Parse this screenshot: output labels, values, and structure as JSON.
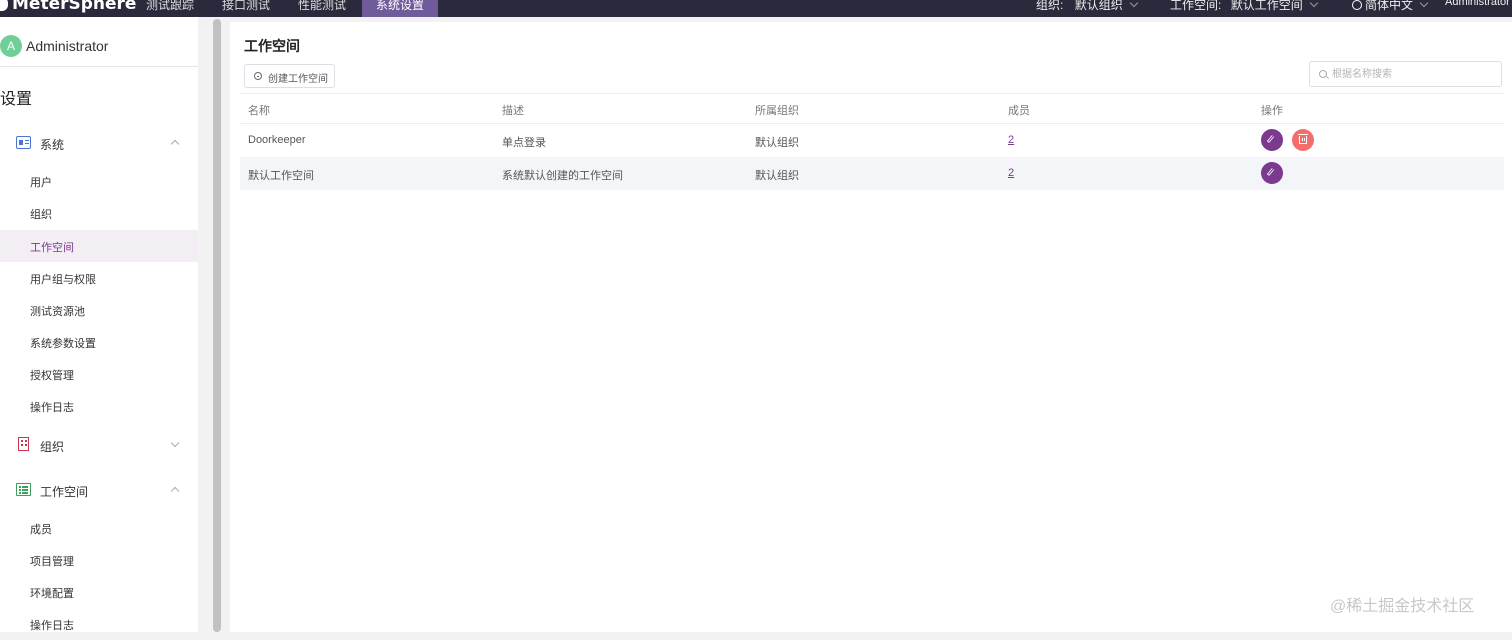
{
  "topbar": {
    "logo_text": "MeterSphere",
    "nav": [
      {
        "label": "测试跟踪"
      },
      {
        "label": "接口测试"
      },
      {
        "label": "性能测试"
      },
      {
        "label": "系统设置",
        "active": true
      }
    ],
    "org_label": "组织:",
    "org_value": "默认组织",
    "workspace_label": "工作空间:",
    "workspace_value": "默认工作空间",
    "language": "简体中文",
    "user": "Administrator"
  },
  "sidebar": {
    "avatar_letter": "A",
    "username": "Administrator",
    "heading": "设置",
    "groups": [
      {
        "label": "系统",
        "icon": "id-card-icon",
        "expanded": true,
        "items": [
          "用户",
          "组织",
          "工作空间",
          "用户组与权限",
          "测试资源池",
          "系统参数设置",
          "授权管理",
          "操作日志"
        ],
        "active_item": "工作空间"
      },
      {
        "label": "组织",
        "icon": "building-icon",
        "expanded": false,
        "items": []
      },
      {
        "label": "工作空间",
        "icon": "list-icon",
        "expanded": true,
        "items": [
          "成员",
          "项目管理",
          "环境配置",
          "操作日志"
        ]
      }
    ]
  },
  "main": {
    "title": "工作空间",
    "create_button": "创建工作空间",
    "search_placeholder": "根据名称搜索",
    "table": {
      "columns": [
        "名称",
        "描述",
        "所属组织",
        "成员",
        "操作"
      ],
      "rows": [
        {
          "name": "Doorkeeper",
          "description": "单点登录",
          "organization": "默认组织",
          "members": "2",
          "actions": [
            "edit",
            "delete"
          ]
        },
        {
          "name": "默认工作空间",
          "description": "系统默认创建的工作空间",
          "organization": "默认组织",
          "members": "2",
          "actions": [
            "edit"
          ]
        }
      ]
    }
  },
  "colors": {
    "topbar_bg": "#2b2a3d",
    "active_nav": "#6f5a9a",
    "primary": "#7b3a8e",
    "danger": "#f56c6c",
    "avatar": "#6fcf97"
  },
  "watermark": "@稀土掘金技术社区"
}
